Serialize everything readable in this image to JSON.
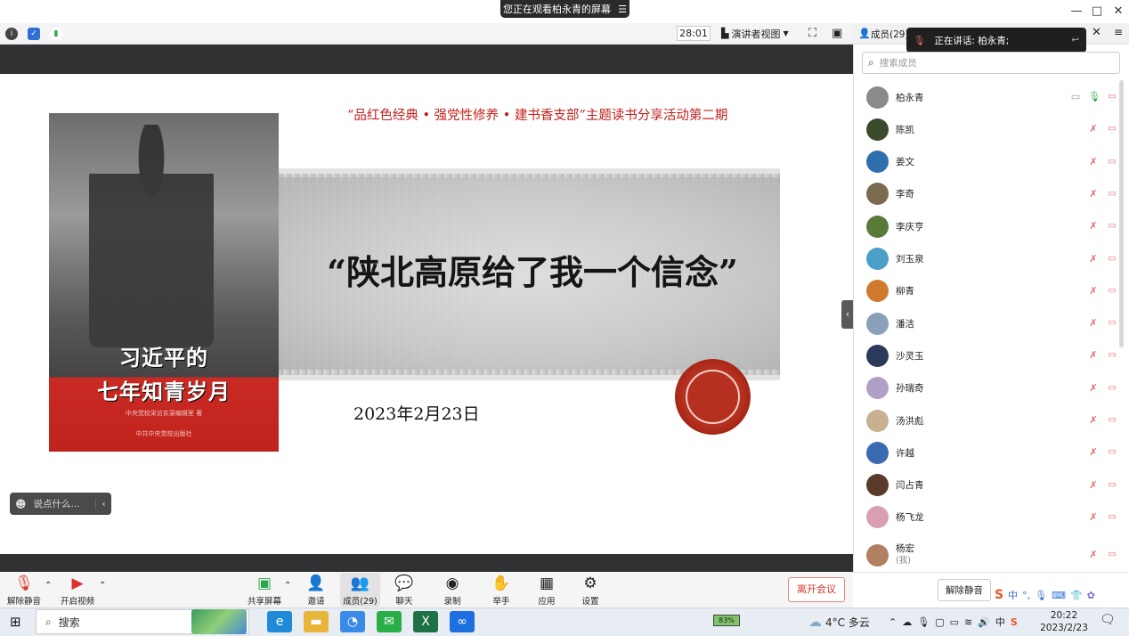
{
  "window": {
    "watch_label": "您正在观看柏永青的屏幕",
    "restore": "□",
    "minimize": "—",
    "close": "✕"
  },
  "toolbar": {
    "timer": "28:01",
    "view_label": "演讲者视图"
  },
  "slide": {
    "subheading": "“品红色经典 • 强党性修养 • 建书香支部”主题读书分享活动第二期",
    "title": "“陕北高原给了我一个信念”",
    "date": "2023年2月23日",
    "book_title_line1": "习近平的",
    "book_title_line2": "七年知青岁月",
    "book_publisher_line1": "中央党校采访实录编辑室 著",
    "book_publisher_line2": "中共中央党校出版社"
  },
  "chat": {
    "placeholder": "说点什么..."
  },
  "bottom_bar": {
    "unmute": "解除静音",
    "start_video": "开启视频",
    "share_screen": "共享屏幕",
    "invite": "邀请",
    "members": "成员(29)",
    "chat": "聊天",
    "record": "录制",
    "raise_hand": "举手",
    "apps": "应用",
    "settings": "设置",
    "leave": "离开会议"
  },
  "panel": {
    "header": "成员(29)",
    "speaking": "正在讲话: 柏永青;",
    "search_placeholder": "搜索成员",
    "members": [
      {
        "name": "柏永青",
        "avatar_color": "#8a8a8a"
      },
      {
        "name": "陈凯",
        "avatar_color": "#3b4a2a"
      },
      {
        "name": "姜文",
        "avatar_color": "#2f6fb0"
      },
      {
        "name": "李奇",
        "avatar_color": "#7a6a50"
      },
      {
        "name": "李庆亨",
        "avatar_color": "#5a7a3a"
      },
      {
        "name": "刘玉泉",
        "avatar_color": "#4aa0c8"
      },
      {
        "name": "柳青",
        "avatar_color": "#d07a30"
      },
      {
        "name": "潘洁",
        "avatar_color": "#8aa0b8"
      },
      {
        "name": "沙灵玉",
        "avatar_color": "#2a3a5a"
      },
      {
        "name": "孙瑞奇",
        "avatar_color": "#b0a0c8"
      },
      {
        "name": "汤洪彪",
        "avatar_color": "#c8b090"
      },
      {
        "name": "许越",
        "avatar_color": "#3a6ab0"
      },
      {
        "name": "闫占青",
        "avatar_color": "#5a3a2a"
      },
      {
        "name": "杨飞龙",
        "avatar_color": "#d8a0b0"
      }
    ],
    "self": {
      "name": "杨宏",
      "tag": "(我)",
      "avatar_color": "#b08060"
    },
    "unmute_all": "解除静音"
  },
  "taskbar": {
    "search": "搜索",
    "battery": "83%",
    "weather": "4°C 多云",
    "time": "20:22",
    "date": "2023/2/23"
  }
}
